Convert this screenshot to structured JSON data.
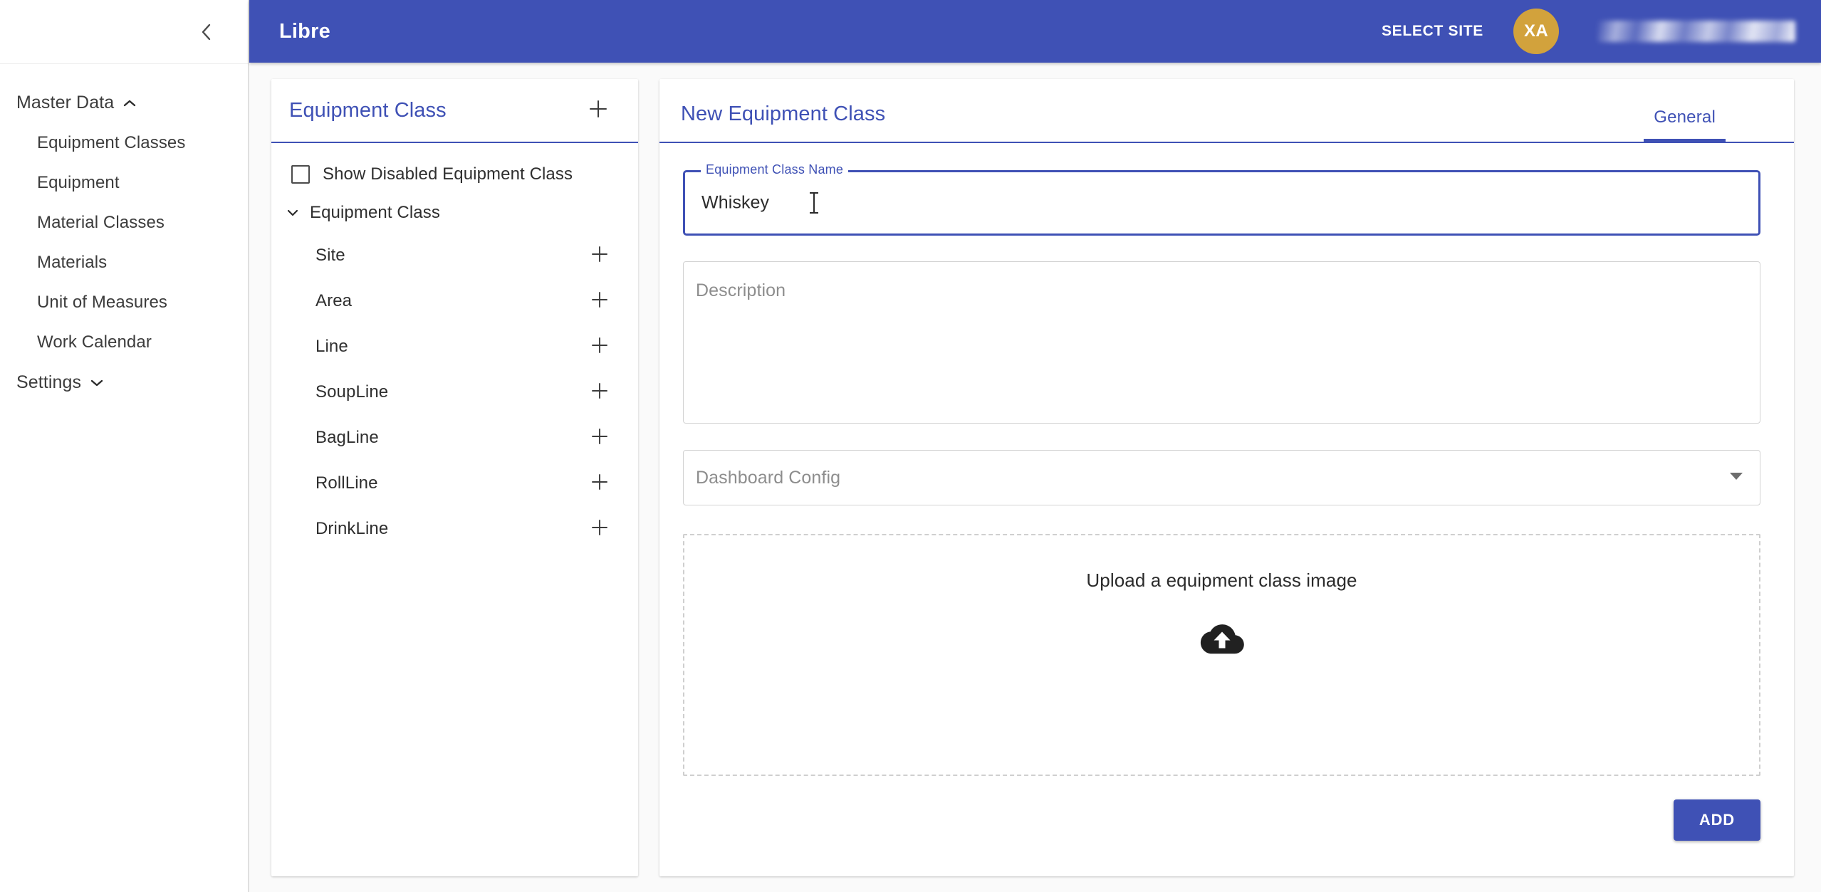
{
  "sidebar": {
    "collapse_icon": "chevron-left-icon",
    "groups": [
      {
        "label": "Master Data",
        "expanded": true,
        "chevron": "chevron-up-icon",
        "items": [
          {
            "label": "Equipment Classes"
          },
          {
            "label": "Equipment"
          },
          {
            "label": "Material Classes"
          },
          {
            "label": "Materials"
          },
          {
            "label": "Unit of Measures"
          },
          {
            "label": "Work Calendar"
          }
        ]
      },
      {
        "label": "Settings",
        "expanded": false,
        "chevron": "chevron-down-icon",
        "items": []
      }
    ]
  },
  "topbar": {
    "brand": "Libre",
    "select_site_label": "SELECT SITE",
    "avatar_initials": "XA",
    "user_name_blurred": "",
    "background_color": "#3f51b5"
  },
  "left_panel": {
    "title": "Equipment Class",
    "add_icon": "plus-icon",
    "show_disabled_label": "Show Disabled Equipment Class",
    "show_disabled_checked": false,
    "tree_root_label": "Equipment Class",
    "tree_root_chevron": "chevron-down-icon",
    "tree_items": [
      {
        "label": "Site"
      },
      {
        "label": "Area"
      },
      {
        "label": "Line"
      },
      {
        "label": "SoupLine"
      },
      {
        "label": "BagLine"
      },
      {
        "label": "RollLine"
      },
      {
        "label": "DrinkLine"
      }
    ]
  },
  "detail_panel": {
    "title": "New Equipment Class",
    "tabs": [
      {
        "label": "General",
        "active": true
      }
    ],
    "fields": {
      "name_label": "Equipment Class Name",
      "name_value": "Whiskey",
      "description_placeholder": "Description",
      "description_value": "",
      "dashboard_config_placeholder": "Dashboard Config",
      "dashboard_config_value": "",
      "dashboard_config_arrow": "chevron-down-icon"
    },
    "upload": {
      "text": "Upload a equipment class image",
      "icon": "cloud-upload-icon"
    },
    "submit_label": "ADD",
    "accent_color": "#3f51b5"
  }
}
